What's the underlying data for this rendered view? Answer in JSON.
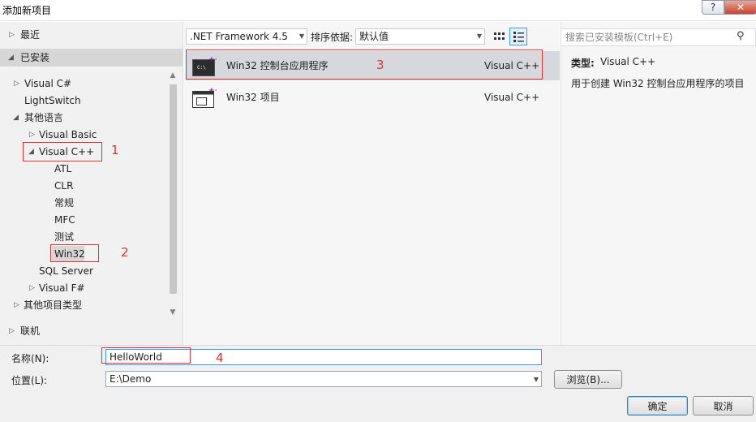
{
  "window": {
    "title": "添加新项目",
    "help": "?",
    "close": "✕"
  },
  "tree": {
    "recent": "最近",
    "installed": "已安装",
    "online": "联机",
    "items": {
      "vcsharp": "Visual C#",
      "lightswitch": "LightSwitch",
      "other_lang": "其他语言",
      "vbasic": "Visual Basic",
      "vcpp": "Visual C++",
      "atl": "ATL",
      "clr": "CLR",
      "general": "常规",
      "mfc": "MFC",
      "test": "测试",
      "win32": "Win32",
      "sql": "SQL Server",
      "vfsharp": "Visual F#",
      "other_proj": "其他项目类型"
    }
  },
  "toolbar": {
    "framework": ".NET Framework 4.5",
    "sort_label": "排序依据:",
    "sort_value": "默认值"
  },
  "templates": [
    {
      "name": "Win32 控制台应用程序",
      "lang": "Visual C++"
    },
    {
      "name": "Win32 项目",
      "lang": "Visual C++"
    }
  ],
  "search": {
    "placeholder": "搜索已安装模板(Ctrl+E)"
  },
  "details": {
    "type_label": "类型:",
    "type_value": "Visual C++",
    "description": "用于创建 Win32 控制台应用程序的项目"
  },
  "form": {
    "name_label": "名称(N):",
    "name_value": "HelloWorld",
    "location_label": "位置(L):",
    "location_value": "E:\\Demo",
    "browse": "浏览(B)...",
    "ok": "确定",
    "cancel": "取消"
  },
  "annotations": {
    "n1": "1",
    "n2": "2",
    "n3": "3",
    "n4": "4"
  }
}
